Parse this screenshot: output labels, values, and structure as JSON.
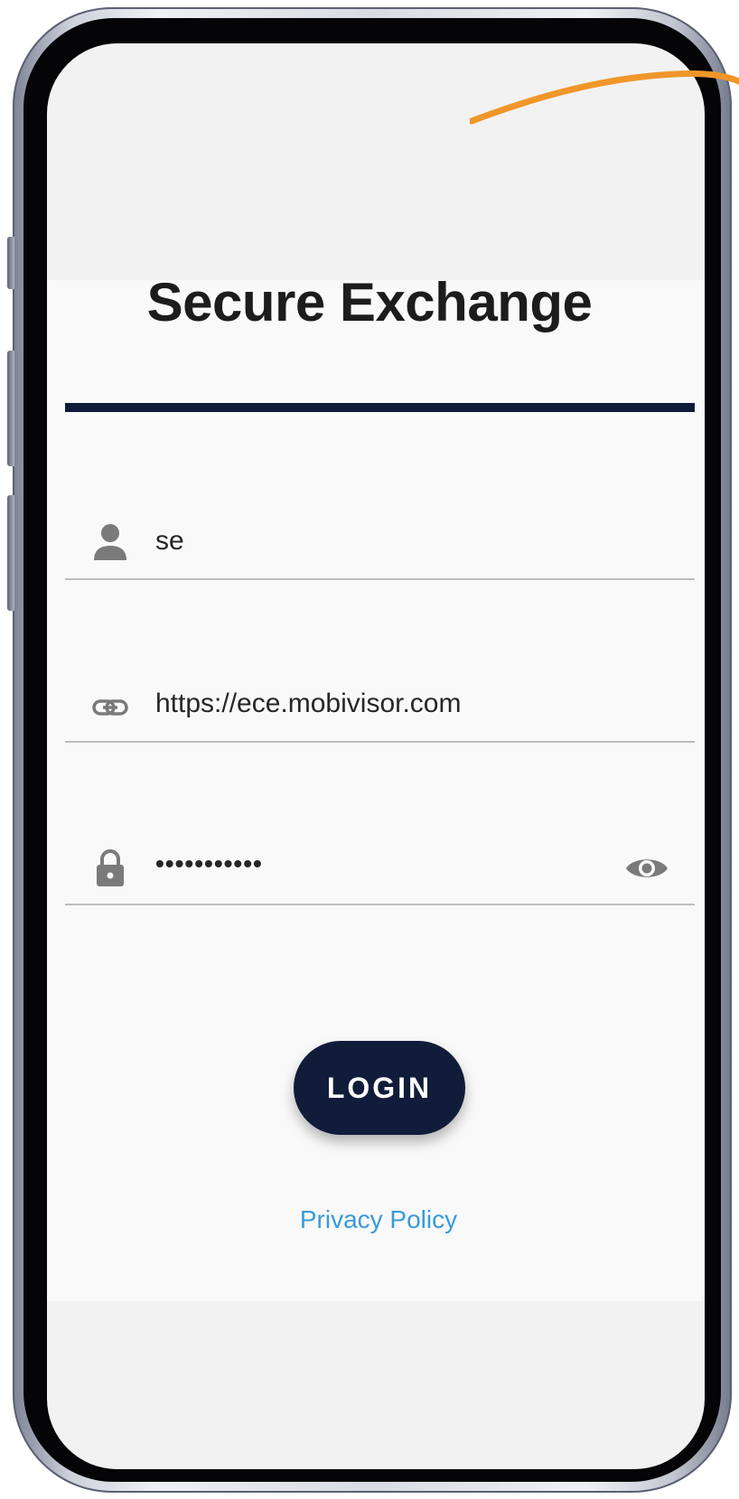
{
  "app": {
    "title": "Secure Exchange"
  },
  "form": {
    "username": {
      "icon": "person-icon",
      "value": "se"
    },
    "server_url": {
      "icon": "link-icon",
      "value": "https://ece.mobivisor.com"
    },
    "password": {
      "icon": "lock-icon",
      "value": "•••••••••••",
      "toggle_icon": "eye-icon"
    }
  },
  "actions": {
    "login_label": "LOGIN",
    "privacy_label": "Privacy Policy"
  },
  "colors": {
    "brand_navy": "#111c3a",
    "link_blue": "#3a9ad9",
    "annotation_orange": "#f0962a"
  }
}
